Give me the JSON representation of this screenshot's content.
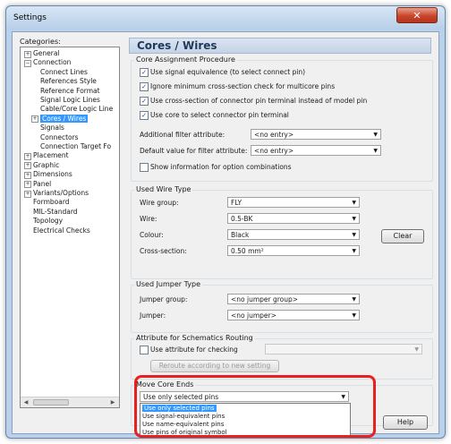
{
  "window": {
    "title": "Settings",
    "close_glyph": "✕"
  },
  "categories": {
    "label": "Categories:",
    "items": [
      {
        "label": "General",
        "expander": "+"
      },
      {
        "label": "Connection",
        "expander": "−"
      },
      {
        "label": "Connect Lines"
      },
      {
        "label": "References Style"
      },
      {
        "label": "Reference Format"
      },
      {
        "label": "Signal Logic Lines"
      },
      {
        "label": "Cable/Core Logic Line"
      },
      {
        "label": "Cores / Wires",
        "expander": "+",
        "selected": true
      },
      {
        "label": "Signals"
      },
      {
        "label": "Connectors"
      },
      {
        "label": "Connection Target Fo"
      },
      {
        "label": "Placement",
        "expander": "+"
      },
      {
        "label": "Graphic",
        "expander": "+"
      },
      {
        "label": "Dimensions",
        "expander": "+"
      },
      {
        "label": "Panel",
        "expander": "+"
      },
      {
        "label": "Variants/Options",
        "expander": "+"
      },
      {
        "label": "Formboard"
      },
      {
        "label": "MIL-Standard"
      },
      {
        "label": "Topology"
      },
      {
        "label": "Electrical Checks"
      }
    ],
    "scroll_left": "◀",
    "scroll_right": "▶"
  },
  "pane": {
    "title": "Cores / Wires",
    "core_assignment": {
      "title": "Core Assignment Procedure",
      "checks": [
        {
          "label": "Use signal equivalence (to select connect pin)",
          "checked": true
        },
        {
          "label": "Ignore minimum cross-section check for multicore pins",
          "checked": true
        },
        {
          "label": "Use cross-section of connector pin terminal instead of model pin",
          "checked": true
        },
        {
          "label": "Use core to select connector pin terminal",
          "checked": true
        }
      ],
      "additional_filter_label": "Additional filter attribute:",
      "additional_filter_value": "<no entry>",
      "default_value_label": "Default value for filter attribute:",
      "default_value_value": "<no entry>",
      "show_info_label": "Show information for option combinations",
      "show_info_checked": false
    },
    "used_wire_type": {
      "title": "Used Wire Type",
      "fields": [
        {
          "label": "Wire group:",
          "value": "FLY"
        },
        {
          "label": "Wire:",
          "value": "0.5-BK"
        },
        {
          "label": "Colour:",
          "value": "Black"
        },
        {
          "label": "Cross-section:",
          "value": "0.50 mm²"
        }
      ],
      "clear_label": "Clear"
    },
    "used_jumper_type": {
      "title": "Used Jumper Type",
      "jumper_group_label": "Jumper group:",
      "jumper_group_value": "<no jumper group>",
      "jumper_label": "Jumper:",
      "jumper_value": "<no jumper>"
    },
    "attribute_routing": {
      "title": "Attribute for Schematics Routing",
      "use_attr_label": "Use attribute for checking",
      "use_attr_checked": false,
      "reroute_label": "Reroute according to new setting"
    },
    "move_core_ends": {
      "title": "Move Core Ends",
      "selected_value": "Use only selected pins",
      "options": [
        "Use only selected pins",
        "Use signal-equivalent pins",
        "Use name-equivalent pins",
        "Use pins of original symbol"
      ]
    },
    "help_label": "Help"
  },
  "check_glyph": "✓",
  "arrow_glyph": "▼"
}
